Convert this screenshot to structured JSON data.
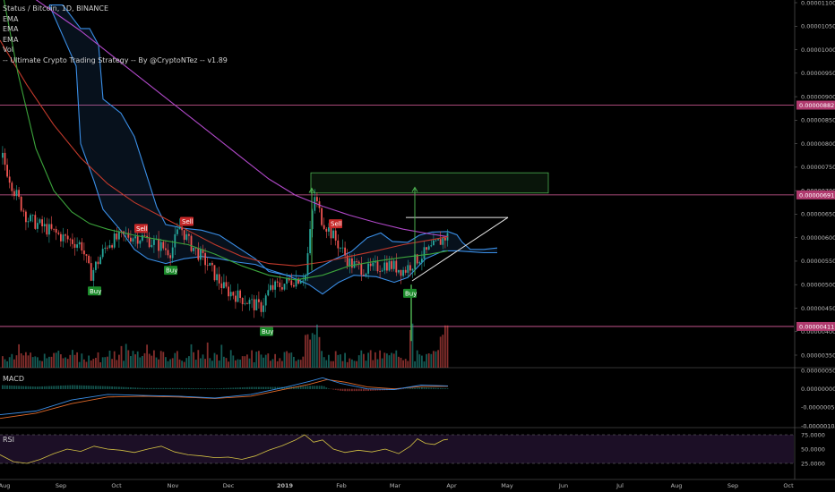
{
  "legend": {
    "title": "Status / Bitcoin, 1D, BINANCE",
    "ema1": "EMA",
    "ema2": "EMA",
    "ema3": "EMA",
    "vol": "Vol",
    "strategy": "-- Ultimate Crypto Trading Strategy -- By @CryptoNTez -- v1.89"
  },
  "panels": {
    "macd_label": "MACD",
    "rsi_label": "RSI"
  },
  "colors": {
    "background": "#000000",
    "ema_red": "#c0392b",
    "ema_green": "#3ba33b",
    "ema_purple": "#b048c8",
    "cloud_blue": "#3a8ee6",
    "hline_pink": "#e060a0",
    "signal_buy": "#1b8a2a",
    "signal_sell": "#c62828",
    "rsi_line": "#d4c243",
    "rsi_bg": "#1c0f26",
    "macd_line": "#3a8ee6",
    "macd_signal": "#e06a2a"
  },
  "chart_data": {
    "type": "candlestick",
    "price_axis": {
      "ticks": [
        "0.00001100",
        "0.00001050",
        "0.00001000",
        "0.00000950",
        "0.00000900",
        "0.00000850",
        "0.00000800",
        "0.00000750",
        "0.00000700",
        "0.00000650",
        "0.00000600",
        "0.00000550",
        "0.00000500",
        "0.00000450",
        "0.00000400",
        "0.00000350"
      ],
      "tick_values": [
        1100,
        1050,
        1000,
        950,
        900,
        850,
        800,
        750,
        700,
        650,
        600,
        550,
        500,
        450,
        400,
        350
      ],
      "ylim": [
        345,
        1105
      ]
    },
    "price_tags": [
      {
        "label": "0.00000882",
        "value": 882
      },
      {
        "label": "0.00000691",
        "value": 691
      },
      {
        "label": "0.00000411",
        "value": 411
      }
    ],
    "x_axis": {
      "ticks": [
        "Aug",
        "Sep",
        "Oct",
        "Nov",
        "Dec",
        "2019",
        "Feb",
        "Mar",
        "Apr",
        "May",
        "Jun",
        "Jul",
        "Aug",
        "Sep",
        "Oct"
      ]
    },
    "ema_fast_red": [
      [
        0,
        1020
      ],
      [
        30,
        925
      ],
      [
        60,
        840
      ],
      [
        90,
        770
      ],
      [
        120,
        715
      ],
      [
        150,
        675
      ],
      [
        180,
        645
      ],
      [
        210,
        615
      ],
      [
        240,
        585
      ],
      [
        270,
        560
      ],
      [
        300,
        545
      ],
      [
        330,
        540
      ],
      [
        360,
        548
      ],
      [
        390,
        560
      ],
      [
        420,
        572
      ],
      [
        450,
        585
      ],
      [
        480,
        595
      ],
      [
        500,
        602
      ]
    ],
    "ema_mid_green": [
      [
        0,
        1150
      ],
      [
        20,
        950
      ],
      [
        40,
        790
      ],
      [
        60,
        700
      ],
      [
        80,
        655
      ],
      [
        100,
        630
      ],
      [
        120,
        618
      ],
      [
        150,
        605
      ],
      [
        180,
        595
      ],
      [
        210,
        585
      ],
      [
        240,
        565
      ],
      [
        270,
        540
      ],
      [
        300,
        520
      ],
      [
        330,
        510
      ],
      [
        360,
        520
      ],
      [
        390,
        540
      ],
      [
        420,
        550
      ],
      [
        450,
        558
      ],
      [
        480,
        565
      ],
      [
        500,
        572
      ]
    ],
    "ema_slow_purple": [
      [
        30,
        1120
      ],
      [
        60,
        1080
      ],
      [
        90,
        1040
      ],
      [
        120,
        995
      ],
      [
        150,
        950
      ],
      [
        180,
        905
      ],
      [
        210,
        860
      ],
      [
        240,
        815
      ],
      [
        270,
        770
      ],
      [
        300,
        725
      ],
      [
        330,
        690
      ],
      [
        360,
        667
      ],
      [
        390,
        648
      ],
      [
        420,
        632
      ],
      [
        450,
        618
      ],
      [
        480,
        608
      ],
      [
        500,
        602
      ]
    ],
    "cloud_upper": [
      [
        55,
        1095
      ],
      [
        70,
        1095
      ],
      [
        90,
        1045
      ],
      [
        100,
        1045
      ],
      [
        110,
        1010
      ],
      [
        115,
        895
      ],
      [
        135,
        865
      ],
      [
        150,
        815
      ],
      [
        160,
        755
      ],
      [
        175,
        665
      ],
      [
        185,
        628
      ],
      [
        205,
        620
      ],
      [
        225,
        616
      ],
      [
        245,
        605
      ],
      [
        265,
        580
      ],
      [
        285,
        555
      ],
      [
        300,
        528
      ],
      [
        320,
        520
      ],
      [
        340,
        518
      ],
      [
        355,
        535
      ],
      [
        372,
        553
      ],
      [
        392,
        570
      ],
      [
        410,
        600
      ],
      [
        425,
        610
      ],
      [
        438,
        592
      ],
      [
        455,
        590
      ],
      [
        468,
        605
      ],
      [
        482,
        612
      ],
      [
        500,
        613
      ],
      [
        510,
        606
      ],
      [
        516,
        590
      ],
      [
        525,
        575
      ],
      [
        540,
        575
      ],
      [
        555,
        578
      ]
    ],
    "cloud_lower": [
      [
        55,
        1095
      ],
      [
        70,
        1030
      ],
      [
        85,
        965
      ],
      [
        90,
        800
      ],
      [
        105,
        720
      ],
      [
        115,
        660
      ],
      [
        135,
        615
      ],
      [
        150,
        575
      ],
      [
        165,
        555
      ],
      [
        185,
        545
      ],
      [
        205,
        555
      ],
      [
        225,
        560
      ],
      [
        245,
        555
      ],
      [
        265,
        548
      ],
      [
        285,
        543
      ],
      [
        300,
        532
      ],
      [
        320,
        520
      ],
      [
        345,
        500
      ],
      [
        360,
        480
      ],
      [
        378,
        505
      ],
      [
        395,
        520
      ],
      [
        420,
        517
      ],
      [
        440,
        505
      ],
      [
        455,
        515
      ],
      [
        475,
        555
      ],
      [
        495,
        572
      ],
      [
        510,
        572
      ],
      [
        525,
        570
      ],
      [
        540,
        568
      ],
      [
        555,
        568
      ]
    ],
    "candles_close_sampled": [
      [
        2,
        770
      ],
      [
        15,
        700
      ],
      [
        30,
        640
      ],
      [
        50,
        620
      ],
      [
        70,
        600
      ],
      [
        90,
        585
      ],
      [
        100,
        520
      ],
      [
        120,
        590
      ],
      [
        140,
        605
      ],
      [
        160,
        600
      ],
      [
        180,
        580
      ],
      [
        190,
        570
      ],
      [
        200,
        625
      ],
      [
        210,
        590
      ],
      [
        230,
        545
      ],
      [
        250,
        490
      ],
      [
        270,
        470
      ],
      [
        290,
        450
      ],
      [
        300,
        490
      ],
      [
        320,
        505
      ],
      [
        340,
        520
      ],
      [
        350,
        690
      ],
      [
        358,
        640
      ],
      [
        372,
        600
      ],
      [
        390,
        545
      ],
      [
        410,
        530
      ],
      [
        430,
        545
      ],
      [
        450,
        530
      ],
      [
        465,
        555
      ],
      [
        480,
        575
      ],
      [
        495,
        600
      ],
      [
        500,
        605
      ]
    ],
    "signals": [
      {
        "type": "Buy",
        "x": 105,
        "price": 496
      },
      {
        "type": "Sell",
        "x": 157,
        "price": 610
      },
      {
        "type": "Buy",
        "x": 190,
        "price": 540
      },
      {
        "type": "Sell",
        "x": 208,
        "price": 625
      },
      {
        "type": "Buy",
        "x": 297,
        "price": 410
      },
      {
        "type": "Sell",
        "x": 374,
        "price": 620
      },
      {
        "type": "Buy",
        "x": 457,
        "price": 491
      }
    ],
    "target_zone": {
      "x0": 347,
      "x1": 612,
      "price_high": 738,
      "price_low": 695
    },
    "triangle_resistance": {
      "x0": 453,
      "x1": 567,
      "price": 643
    },
    "triangle_support": {
      "x0": 460,
      "price0": 508,
      "x1": 567,
      "price1": 643
    },
    "macd": {
      "ticks": [
        "0.00000050",
        "0.00000000",
        "-0.00000050",
        "-0.00000100"
      ],
      "tick_values": [
        50,
        0,
        -50,
        -100
      ],
      "macd_line": [
        [
          0,
          -70
        ],
        [
          40,
          -60
        ],
        [
          80,
          -30
        ],
        [
          120,
          -15
        ],
        [
          160,
          -18
        ],
        [
          200,
          -20
        ],
        [
          240,
          -25
        ],
        [
          280,
          -15
        ],
        [
          320,
          5
        ],
        [
          345,
          20
        ],
        [
          360,
          30
        ],
        [
          380,
          15
        ],
        [
          410,
          0
        ],
        [
          440,
          -2
        ],
        [
          470,
          10
        ],
        [
          500,
          8
        ]
      ],
      "signal_line": [
        [
          0,
          -80
        ],
        [
          40,
          -66
        ],
        [
          80,
          -40
        ],
        [
          120,
          -22
        ],
        [
          160,
          -20
        ],
        [
          200,
          -22
        ],
        [
          240,
          -26
        ],
        [
          280,
          -20
        ],
        [
          320,
          0
        ],
        [
          345,
          12
        ],
        [
          365,
          25
        ],
        [
          385,
          18
        ],
        [
          410,
          5
        ],
        [
          440,
          0
        ],
        [
          470,
          6
        ],
        [
          500,
          7
        ]
      ]
    },
    "rsi": {
      "ticks": [
        "75.0000",
        "50.0000",
        "25.0000"
      ],
      "tick_values": [
        75,
        50,
        25
      ],
      "line": [
        [
          0,
          40
        ],
        [
          15,
          28
        ],
        [
          30,
          25
        ],
        [
          45,
          32
        ],
        [
          60,
          42
        ],
        [
          75,
          50
        ],
        [
          90,
          46
        ],
        [
          105,
          55
        ],
        [
          120,
          50
        ],
        [
          135,
          48
        ],
        [
          150,
          44
        ],
        [
          165,
          50
        ],
        [
          180,
          55
        ],
        [
          195,
          45
        ],
        [
          210,
          40
        ],
        [
          225,
          38
        ],
        [
          240,
          35
        ],
        [
          255,
          36
        ],
        [
          270,
          32
        ],
        [
          285,
          38
        ],
        [
          300,
          48
        ],
        [
          315,
          56
        ],
        [
          330,
          66
        ],
        [
          340,
          75
        ],
        [
          350,
          62
        ],
        [
          360,
          66
        ],
        [
          372,
          50
        ],
        [
          385,
          44
        ],
        [
          400,
          48
        ],
        [
          415,
          45
        ],
        [
          430,
          50
        ],
        [
          445,
          42
        ],
        [
          458,
          55
        ],
        [
          466,
          68
        ],
        [
          475,
          60
        ],
        [
          485,
          58
        ],
        [
          495,
          66
        ],
        [
          500,
          67
        ]
      ]
    }
  }
}
